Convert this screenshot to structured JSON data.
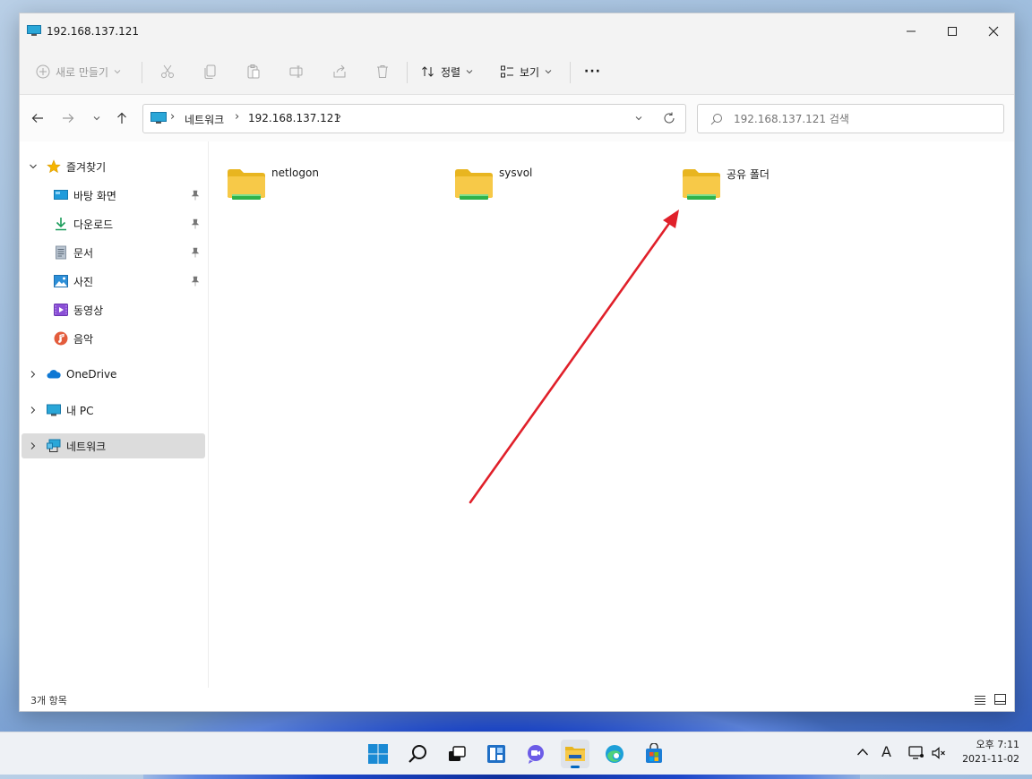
{
  "window": {
    "title": "192.168.137.121",
    "controls": [
      "minimize",
      "maximize",
      "close"
    ]
  },
  "toolbar": {
    "new_label": "새로 만들기",
    "sort_label": "정렬",
    "view_label": "보기",
    "more_label": "···"
  },
  "nav": {
    "breadcrumb": [
      "네트워크",
      "192.168.137.121"
    ],
    "search_placeholder": "192.168.137.121 검색"
  },
  "sidebar": {
    "favorites": {
      "label": "즐겨찾기",
      "items": [
        {
          "label": "바탕 화면",
          "icon": "desktop-icon",
          "pinned": true
        },
        {
          "label": "다운로드",
          "icon": "download-icon",
          "pinned": true
        },
        {
          "label": "문서",
          "icon": "document-icon",
          "pinned": true
        },
        {
          "label": "사진",
          "icon": "pictures-icon",
          "pinned": true
        },
        {
          "label": "동영상",
          "icon": "videos-icon",
          "pinned": false
        },
        {
          "label": "음악",
          "icon": "music-icon",
          "pinned": false
        }
      ]
    },
    "onedrive": {
      "label": "OneDrive"
    },
    "thispc": {
      "label": "내 PC"
    },
    "network": {
      "label": "네트워크"
    }
  },
  "content": {
    "folders": [
      {
        "name": "netlogon"
      },
      {
        "name": "sysvol"
      },
      {
        "name": "공유 폴더"
      }
    ]
  },
  "status": {
    "count_text": "3개 항목"
  },
  "tray": {
    "ime": "A",
    "time": "오후 7:11",
    "date": "2021-11-02"
  },
  "colors": {
    "folder_yellow": "#f7c948",
    "share_green": "#2fb24a",
    "annotation_red": "#e0202a",
    "accent_blue": "#0067c0"
  }
}
